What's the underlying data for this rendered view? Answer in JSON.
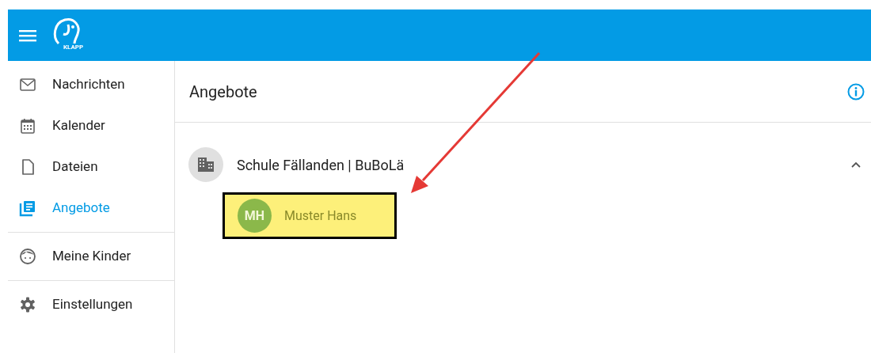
{
  "header": {
    "logo_text": "KLAPP"
  },
  "sidebar": {
    "groups": [
      [
        {
          "kind": "mail",
          "label": "Nachrichten",
          "selected": false
        },
        {
          "kind": "calendar",
          "label": "Kalender",
          "selected": false
        },
        {
          "kind": "file",
          "label": "Dateien",
          "selected": false
        },
        {
          "kind": "offers",
          "label": "Angebote",
          "selected": true
        }
      ],
      [
        {
          "kind": "child",
          "label": "Meine Kinder",
          "selected": false
        }
      ],
      [
        {
          "kind": "settings",
          "label": "Einstellungen",
          "selected": false
        }
      ]
    ]
  },
  "page": {
    "title": "Angebote",
    "schools": [
      {
        "name": "Schule Fällanden | BuBoLä",
        "expanded": true,
        "children": [
          {
            "initials": "MH",
            "name": "Muster Hans",
            "highlighted": true
          }
        ]
      }
    ]
  },
  "annotation": {
    "arrow": true
  }
}
